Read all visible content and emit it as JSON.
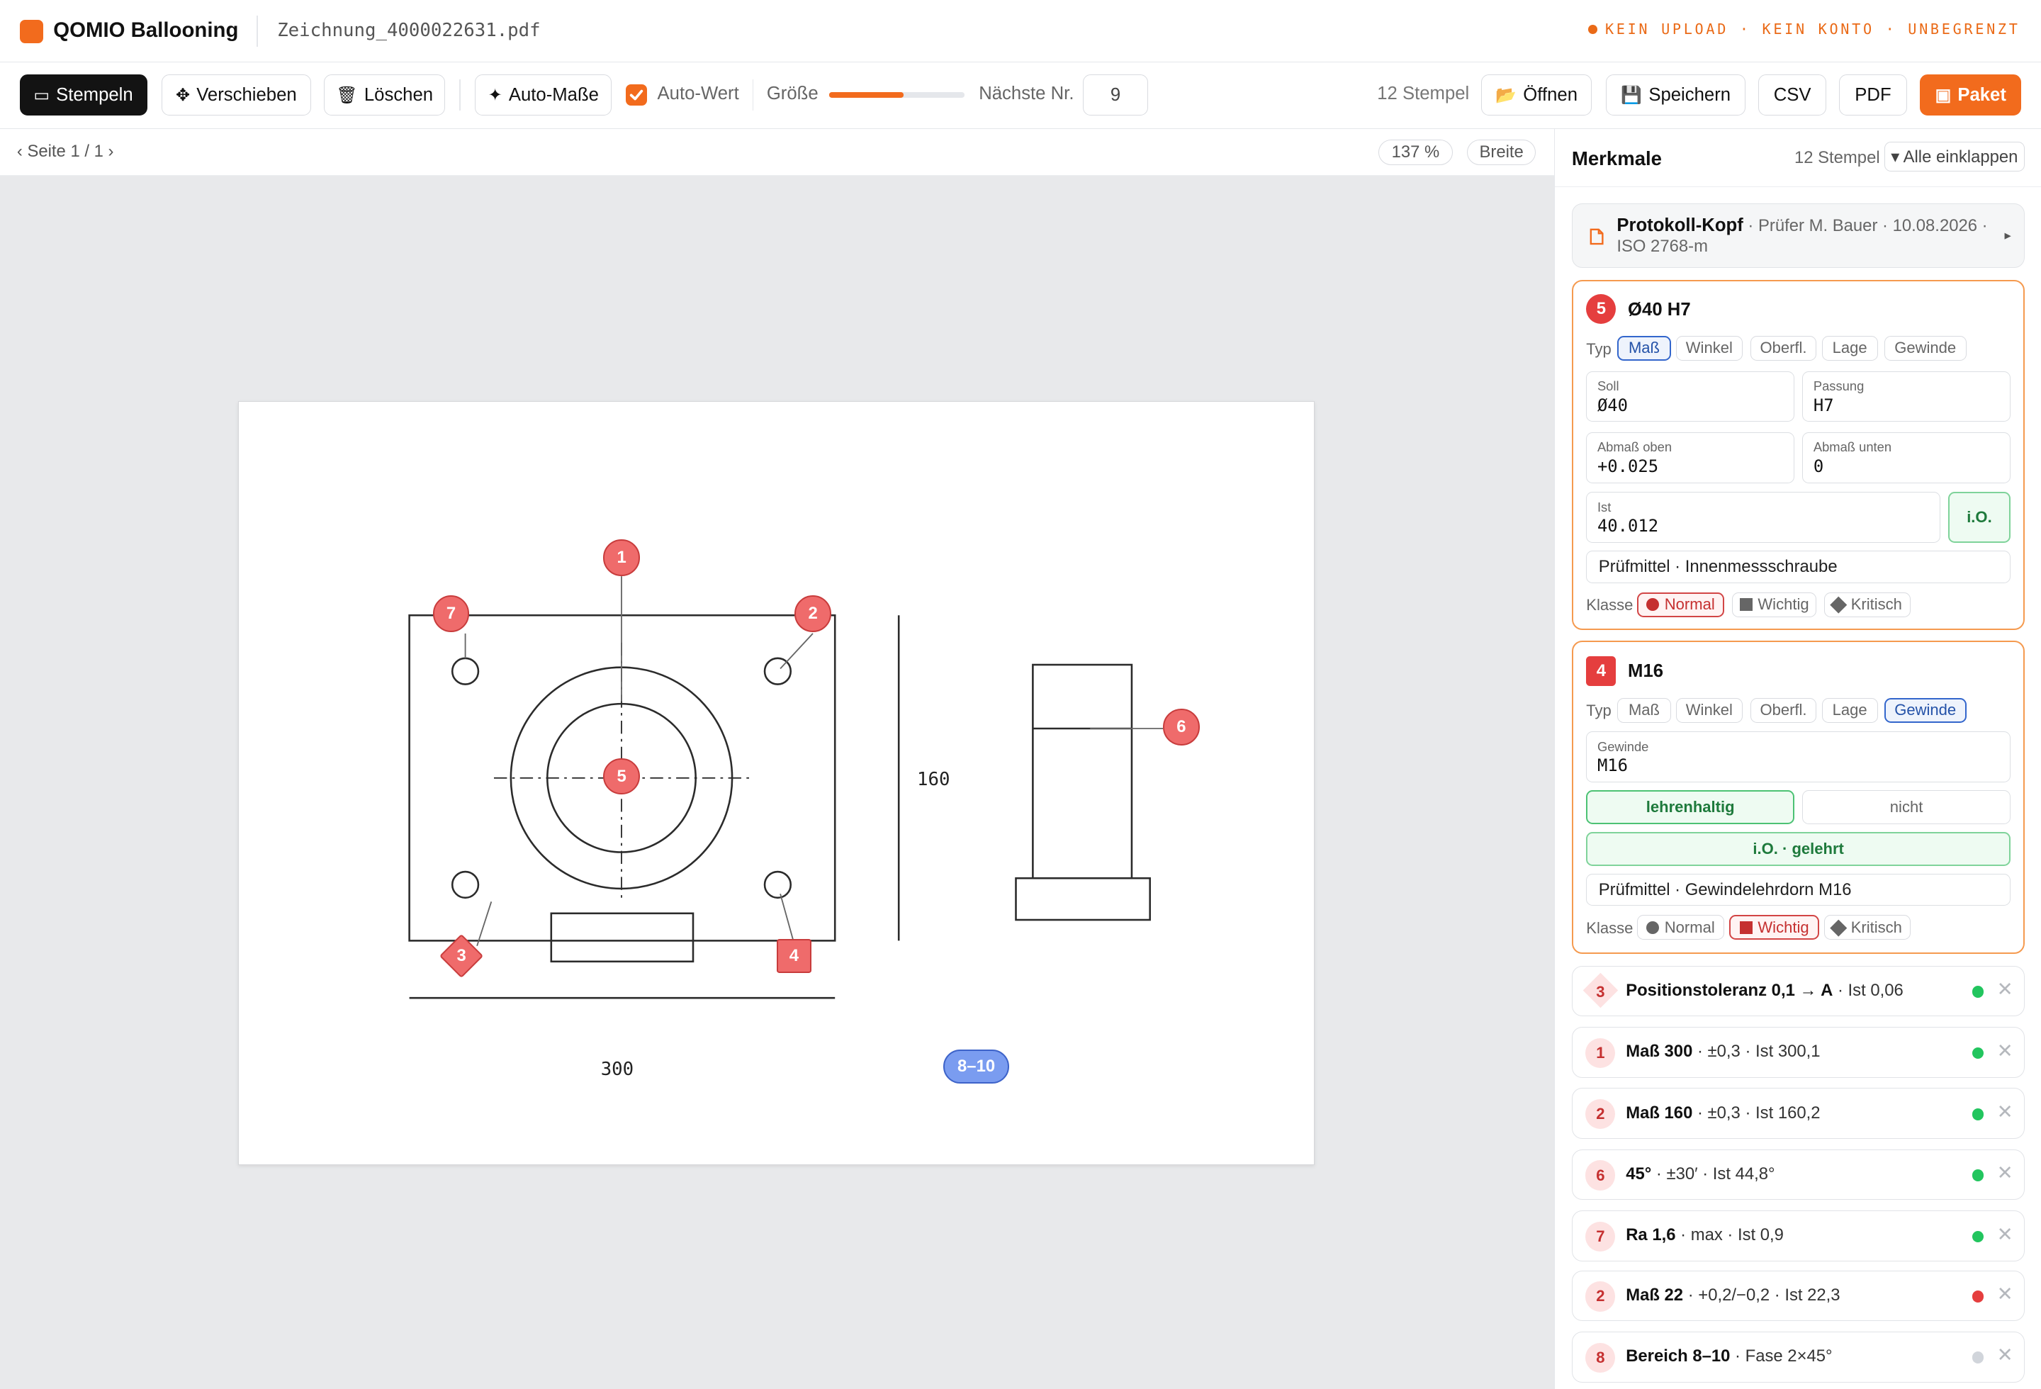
{
  "app": {
    "title": "QOMIO Ballooning",
    "filename": "Zeichnung_4000022631.pdf",
    "tagline": "KEIN UPLOAD · KEIN KONTO · UNBEGRENZT",
    "brand_color": "#f26b1d"
  },
  "toolbar": {
    "stamp_icon": "▭",
    "stamp_label": "Stempeln",
    "move_icon": "✥",
    "move_label": "Verschieben",
    "delete_icon": "🗑",
    "delete_label": "Löschen",
    "auto_dims_icon": "✦",
    "auto_dims_label": "Auto-Maße",
    "auto_value_label": "Auto-Wert",
    "auto_value_checked": true,
    "size_label": "Größe",
    "size_level": 0.55,
    "next_no_label": "Nächste Nr.",
    "next_no_value": "9",
    "stamp_count": "12 Stempel",
    "open_icon": "📂",
    "open_label": "Öffnen",
    "save_icon": "💾",
    "save_label": "Speichern",
    "csv_label": "CSV",
    "pdf_label": "PDF",
    "package_icon": "▣",
    "package_label": "Paket"
  },
  "viewer": {
    "page_nav": "‹ Seite 1 / 1 ›",
    "zoom": "137 %",
    "fit_label": "Breite",
    "dim_300": "300",
    "dim_160": "160",
    "balloons": [
      "1",
      "2",
      "3",
      "4",
      "5",
      "6",
      "7"
    ],
    "range_label": "8–10"
  },
  "panel": {
    "title": "Merkmale",
    "count": "12 Stempel",
    "collapse_label": "▾ Alle einklappen",
    "protocol": {
      "title": "Protokoll-Kopf",
      "details": " · Prüfer M. Bauer · 10.08.2026 · ISO 2768-m",
      "arrow": "▸"
    },
    "card5": {
      "number": "5",
      "title": "Ø40 H7",
      "type_label": "Typ",
      "types": [
        "Maß",
        "Winkel",
        "Oberfl.",
        "Lage",
        "Gewinde"
      ],
      "selected_type": "Maß",
      "nominal_label": "Soll",
      "nominal_value": "Ø40",
      "fit_label": "Passung",
      "fit_value": "H7",
      "upper_label": "Abmaß oben",
      "upper_value": "+0.025",
      "lower_label": "Abmaß unten",
      "lower_value": "0",
      "actual_label": "Ist",
      "actual_value": "40.012",
      "status": "i.O.",
      "tool": "Prüfmittel · Innenmessschraube",
      "class_label": "Klasse",
      "classes": [
        "Normal",
        "Wichtig",
        "Kritisch"
      ],
      "selected_class": "Normal"
    },
    "card4": {
      "number": "4",
      "title": "M16",
      "type_label": "Typ",
      "types": [
        "Maß",
        "Winkel",
        "Oberfl.",
        "Lage",
        "Gewinde"
      ],
      "selected_type": "Gewinde",
      "thread_label": "Gewinde",
      "thread_value": "M16",
      "gauge_ok": "lehrenhaltig",
      "gauge_not": "nicht",
      "status": "i.O. · gelehrt",
      "tool": "Prüfmittel · Gewindelehrdorn M16",
      "class_label": "Klasse",
      "classes": [
        "Normal",
        "Wichtig",
        "Kritisch"
      ],
      "selected_class": "Wichtig"
    },
    "rows": [
      {
        "badge": "3",
        "shape": "diamond",
        "title": "Positionstoleranz 0,1 → A",
        "rest": " · Ist 0,06",
        "status_color": "#22c55e"
      },
      {
        "badge": "1",
        "shape": "circle",
        "title": "Maß 300",
        "rest": " · ±0,3 · Ist 300,1",
        "status_color": "#22c55e"
      },
      {
        "badge": "2",
        "shape": "circle",
        "title": "Maß 160",
        "rest": " · ±0,3 · Ist 160,2",
        "status_color": "#22c55e"
      },
      {
        "badge": "6",
        "shape": "circle",
        "title": "45°",
        "rest": " · ±30′ · Ist 44,8°",
        "status_color": "#22c55e"
      },
      {
        "badge": "7",
        "shape": "circle",
        "title": "Ra 1,6",
        "rest": " · max · Ist 0,9",
        "status_color": "#22c55e"
      },
      {
        "badge": "2",
        "shape": "circle",
        "title": "Maß 22",
        "rest": " · +0,2/−0,2 · Ist 22,3",
        "status_color": "#e53e3e"
      },
      {
        "badge": "8",
        "shape": "circle",
        "title": "Bereich 8–10",
        "rest": " · Fase 2×45°",
        "status_color": "#d1d5db"
      }
    ],
    "remove_glyph": "✕"
  }
}
